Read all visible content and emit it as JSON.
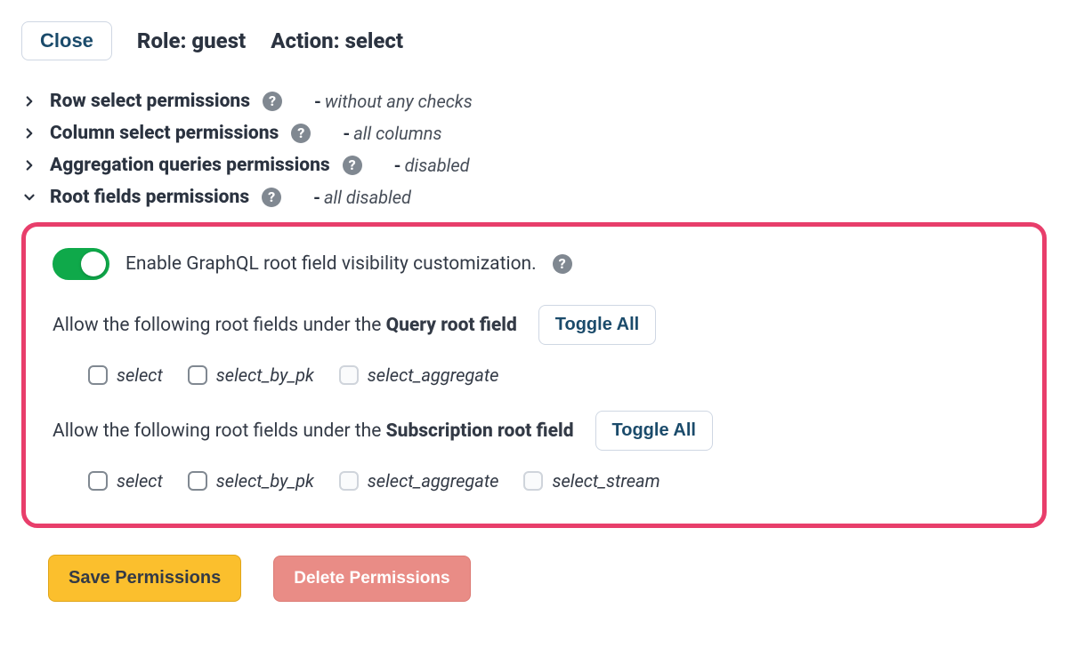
{
  "header": {
    "close_label": "Close",
    "role_label": "Role: guest",
    "action_label": "Action: select"
  },
  "sections": [
    {
      "title": "Row select permissions",
      "summary": "without any checks",
      "expanded": false
    },
    {
      "title": "Column select permissions",
      "summary": "all columns",
      "expanded": false
    },
    {
      "title": "Aggregation queries permissions",
      "summary": "disabled",
      "expanded": false
    },
    {
      "title": "Root fields permissions",
      "summary": "all disabled",
      "expanded": true
    }
  ],
  "root_fields": {
    "enable_label": "Enable GraphQL root field visibility customization.",
    "toggle_on": true,
    "query": {
      "prompt_prefix": "Allow the following root fields under the ",
      "prompt_bold": "Query root field",
      "toggle_all_label": "Toggle All",
      "fields": [
        {
          "label": "select",
          "disabled": false
        },
        {
          "label": "select_by_pk",
          "disabled": false
        },
        {
          "label": "select_aggregate",
          "disabled": true
        }
      ]
    },
    "subscription": {
      "prompt_prefix": "Allow the following root fields under the ",
      "prompt_bold": "Subscription root field",
      "toggle_all_label": "Toggle All",
      "fields": [
        {
          "label": "select",
          "disabled": false
        },
        {
          "label": "select_by_pk",
          "disabled": false
        },
        {
          "label": "select_aggregate",
          "disabled": true
        },
        {
          "label": "select_stream",
          "disabled": true
        }
      ]
    }
  },
  "footer": {
    "save_label": "Save Permissions",
    "delete_label": "Delete Permissions"
  }
}
